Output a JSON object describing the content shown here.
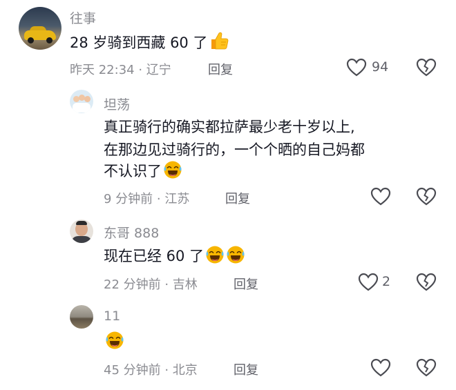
{
  "comments": [
    {
      "username": "往事",
      "text": "28 岁骑到西藏 60 了",
      "time_location": "昨天 22:34 · 辽宁",
      "reply_label": "回复",
      "like_count": "94",
      "emojis": [
        "thumbs-up-icon"
      ],
      "replies": [
        {
          "username": "坦荡",
          "text_lines": [
            "真正骑行的确实都拉萨最少老十岁以上,",
            "在那边见过骑行的，一个个晒的自己妈都",
            "不认识了"
          ],
          "time_location": "9 分钟前 · 江苏",
          "reply_label": "回复",
          "like_count": "",
          "emojis": [
            "laughing-crying-icon"
          ]
        },
        {
          "username": "东哥 888",
          "text": "现在已经 60 了",
          "time_location": "22 分钟前 · 吉林",
          "reply_label": "回复",
          "like_count": "2",
          "emojis": [
            "laughing-crying-icon",
            "laughing-crying-icon"
          ]
        },
        {
          "username": "11",
          "text": "",
          "time_location": "45 分钟前 · 北京",
          "reply_label": "回复",
          "like_count": "",
          "emojis": [
            "laughing-crying-icon"
          ]
        }
      ]
    }
  ],
  "colors": {
    "secondary_text": "#8a8b91",
    "primary_text": "#161823",
    "icon": "#4a4b52",
    "emoji": "#f7b500"
  }
}
